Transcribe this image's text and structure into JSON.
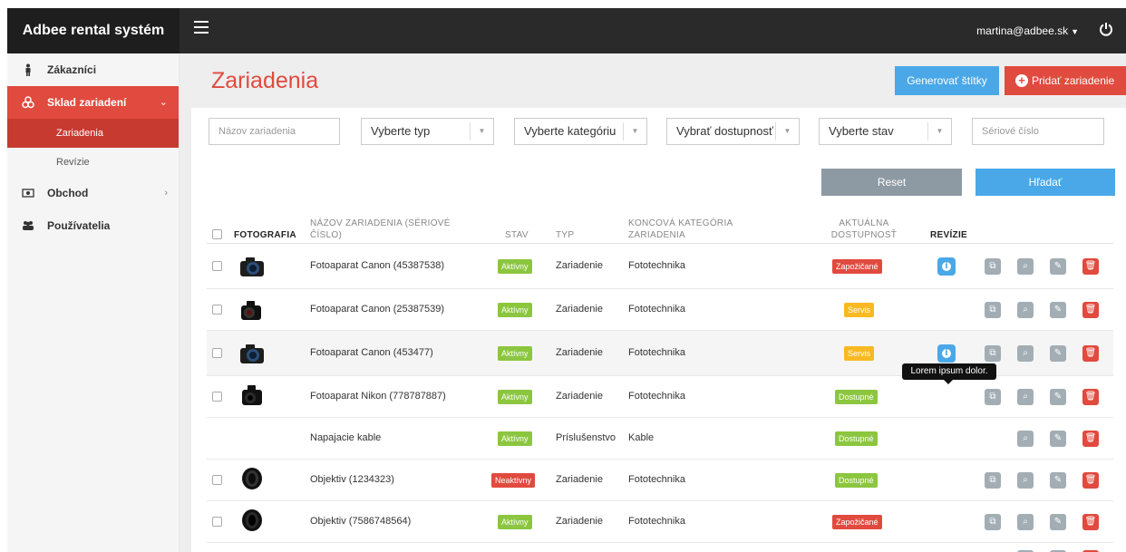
{
  "app": {
    "brand": "Adbee rental systém",
    "user_email": "martina@adbee.sk"
  },
  "sidebar": {
    "items": [
      {
        "label": "Zákazníci"
      },
      {
        "label": "Sklad zariadení"
      },
      {
        "label": "Obchod"
      },
      {
        "label": "Používatelia"
      }
    ],
    "sub_items": [
      {
        "label": "Zariadenia"
      },
      {
        "label": "Revízie"
      }
    ]
  },
  "page": {
    "title": "Zariadenia",
    "generate_labels_button": "Generovať štítky",
    "add_device_button": "Pridať zariadenie"
  },
  "filters": {
    "name_placeholder": "Názov zariadenia",
    "type_select": "Vyberte typ",
    "category_select": "Vyberte kategóriu",
    "availability_select": "Vybrať dostupnosť",
    "state_select": "Vyberte stav",
    "serial_placeholder": "Sériové číslo",
    "reset_button": "Reset",
    "search_button": "Hľadať"
  },
  "table": {
    "headers": {
      "photo": "FOTOGRAFIA",
      "name_line1": "NÁZOV ZARIADENIA (SÉRIOVÉ",
      "name_line2": "ČÍSLO)",
      "state": "STAV",
      "type": "TYP",
      "category_line1": "KONCOVÁ KATEGÓRIA",
      "category_line2": "ZARIADENIA",
      "availability_line1": "AKTUÁLNA",
      "availability_line2": "DOSTUPNOSŤ",
      "revisions": "REVÍZIE"
    },
    "rows": [
      {
        "name": "Fotoaparat Canon (45387538)",
        "state": "Aktívny",
        "type": "Zariadenie",
        "category": "Fototechnika",
        "availability": "Zapožičané"
      },
      {
        "name": "Fotoaparat Canon (25387539)",
        "state": "Aktívny",
        "type": "Zariadenie",
        "category": "Fototechnika",
        "availability": "Servis"
      },
      {
        "name": "Fotoaparat Canon (453477)",
        "state": "Aktívny",
        "type": "Zariadenie",
        "category": "Fototechnika",
        "availability": "Servis"
      },
      {
        "name": "Fotoaparat Nikon (778787887)",
        "state": "Aktívny",
        "type": "Zariadenie",
        "category": "Fototechnika",
        "availability": "Dostupné"
      },
      {
        "name": "Napajacie kable",
        "state": "Aktívny",
        "type": "Príslušenstvo",
        "category": "Kable",
        "availability": "Dostupné"
      },
      {
        "name": "Objektiv (1234323)",
        "state": "Neaktívny",
        "type": "Zariadenie",
        "category": "Fototechnika",
        "availability": "Dostupné"
      },
      {
        "name": "Objektiv (7586748564)",
        "state": "Aktívny",
        "type": "Zariadenie",
        "category": "Fototechnika",
        "availability": "Zapožičané"
      }
    ],
    "tooltip": "Lorem ipsum dolor."
  },
  "colors": {
    "accent_red": "#e14a3e",
    "accent_blue": "#4aa8e8",
    "status_green": "#8cc63f",
    "status_yellow": "#f8b921"
  }
}
